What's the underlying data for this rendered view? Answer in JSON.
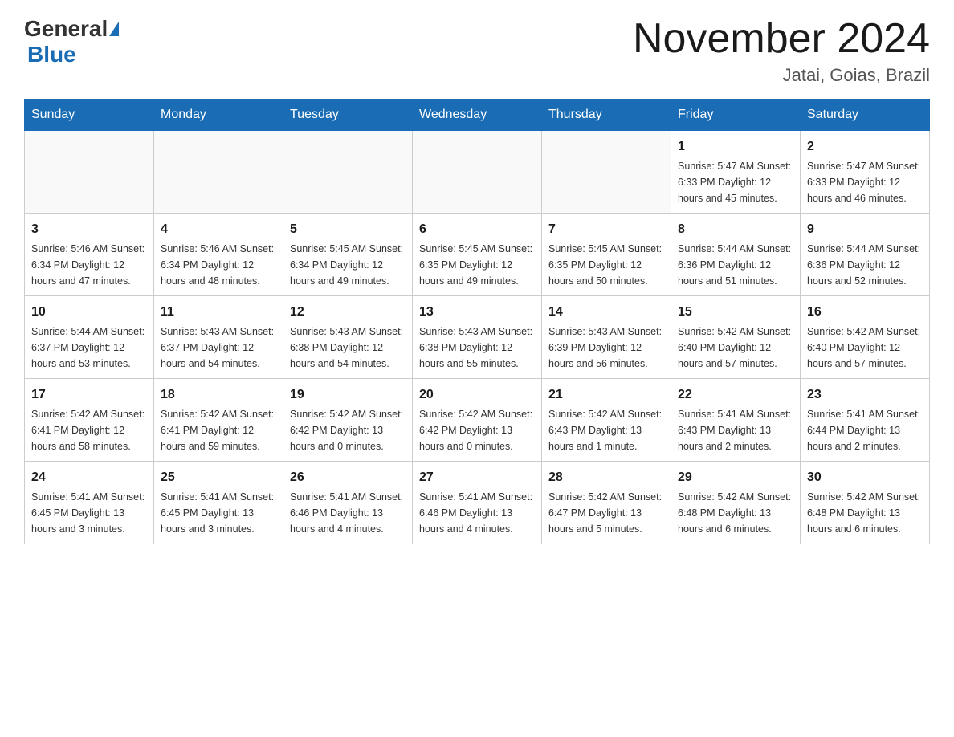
{
  "header": {
    "logo_general": "General",
    "logo_blue": "Blue",
    "month_title": "November 2024",
    "location": "Jatai, Goias, Brazil"
  },
  "weekdays": [
    "Sunday",
    "Monday",
    "Tuesday",
    "Wednesday",
    "Thursday",
    "Friday",
    "Saturday"
  ],
  "weeks": [
    [
      {
        "day": "",
        "info": ""
      },
      {
        "day": "",
        "info": ""
      },
      {
        "day": "",
        "info": ""
      },
      {
        "day": "",
        "info": ""
      },
      {
        "day": "",
        "info": ""
      },
      {
        "day": "1",
        "info": "Sunrise: 5:47 AM\nSunset: 6:33 PM\nDaylight: 12 hours\nand 45 minutes."
      },
      {
        "day": "2",
        "info": "Sunrise: 5:47 AM\nSunset: 6:33 PM\nDaylight: 12 hours\nand 46 minutes."
      }
    ],
    [
      {
        "day": "3",
        "info": "Sunrise: 5:46 AM\nSunset: 6:34 PM\nDaylight: 12 hours\nand 47 minutes."
      },
      {
        "day": "4",
        "info": "Sunrise: 5:46 AM\nSunset: 6:34 PM\nDaylight: 12 hours\nand 48 minutes."
      },
      {
        "day": "5",
        "info": "Sunrise: 5:45 AM\nSunset: 6:34 PM\nDaylight: 12 hours\nand 49 minutes."
      },
      {
        "day": "6",
        "info": "Sunrise: 5:45 AM\nSunset: 6:35 PM\nDaylight: 12 hours\nand 49 minutes."
      },
      {
        "day": "7",
        "info": "Sunrise: 5:45 AM\nSunset: 6:35 PM\nDaylight: 12 hours\nand 50 minutes."
      },
      {
        "day": "8",
        "info": "Sunrise: 5:44 AM\nSunset: 6:36 PM\nDaylight: 12 hours\nand 51 minutes."
      },
      {
        "day": "9",
        "info": "Sunrise: 5:44 AM\nSunset: 6:36 PM\nDaylight: 12 hours\nand 52 minutes."
      }
    ],
    [
      {
        "day": "10",
        "info": "Sunrise: 5:44 AM\nSunset: 6:37 PM\nDaylight: 12 hours\nand 53 minutes."
      },
      {
        "day": "11",
        "info": "Sunrise: 5:43 AM\nSunset: 6:37 PM\nDaylight: 12 hours\nand 54 minutes."
      },
      {
        "day": "12",
        "info": "Sunrise: 5:43 AM\nSunset: 6:38 PM\nDaylight: 12 hours\nand 54 minutes."
      },
      {
        "day": "13",
        "info": "Sunrise: 5:43 AM\nSunset: 6:38 PM\nDaylight: 12 hours\nand 55 minutes."
      },
      {
        "day": "14",
        "info": "Sunrise: 5:43 AM\nSunset: 6:39 PM\nDaylight: 12 hours\nand 56 minutes."
      },
      {
        "day": "15",
        "info": "Sunrise: 5:42 AM\nSunset: 6:40 PM\nDaylight: 12 hours\nand 57 minutes."
      },
      {
        "day": "16",
        "info": "Sunrise: 5:42 AM\nSunset: 6:40 PM\nDaylight: 12 hours\nand 57 minutes."
      }
    ],
    [
      {
        "day": "17",
        "info": "Sunrise: 5:42 AM\nSunset: 6:41 PM\nDaylight: 12 hours\nand 58 minutes."
      },
      {
        "day": "18",
        "info": "Sunrise: 5:42 AM\nSunset: 6:41 PM\nDaylight: 12 hours\nand 59 minutes."
      },
      {
        "day": "19",
        "info": "Sunrise: 5:42 AM\nSunset: 6:42 PM\nDaylight: 13 hours\nand 0 minutes."
      },
      {
        "day": "20",
        "info": "Sunrise: 5:42 AM\nSunset: 6:42 PM\nDaylight: 13 hours\nand 0 minutes."
      },
      {
        "day": "21",
        "info": "Sunrise: 5:42 AM\nSunset: 6:43 PM\nDaylight: 13 hours\nand 1 minute."
      },
      {
        "day": "22",
        "info": "Sunrise: 5:41 AM\nSunset: 6:43 PM\nDaylight: 13 hours\nand 2 minutes."
      },
      {
        "day": "23",
        "info": "Sunrise: 5:41 AM\nSunset: 6:44 PM\nDaylight: 13 hours\nand 2 minutes."
      }
    ],
    [
      {
        "day": "24",
        "info": "Sunrise: 5:41 AM\nSunset: 6:45 PM\nDaylight: 13 hours\nand 3 minutes."
      },
      {
        "day": "25",
        "info": "Sunrise: 5:41 AM\nSunset: 6:45 PM\nDaylight: 13 hours\nand 3 minutes."
      },
      {
        "day": "26",
        "info": "Sunrise: 5:41 AM\nSunset: 6:46 PM\nDaylight: 13 hours\nand 4 minutes."
      },
      {
        "day": "27",
        "info": "Sunrise: 5:41 AM\nSunset: 6:46 PM\nDaylight: 13 hours\nand 4 minutes."
      },
      {
        "day": "28",
        "info": "Sunrise: 5:42 AM\nSunset: 6:47 PM\nDaylight: 13 hours\nand 5 minutes."
      },
      {
        "day": "29",
        "info": "Sunrise: 5:42 AM\nSunset: 6:48 PM\nDaylight: 13 hours\nand 6 minutes."
      },
      {
        "day": "30",
        "info": "Sunrise: 5:42 AM\nSunset: 6:48 PM\nDaylight: 13 hours\nand 6 minutes."
      }
    ]
  ]
}
